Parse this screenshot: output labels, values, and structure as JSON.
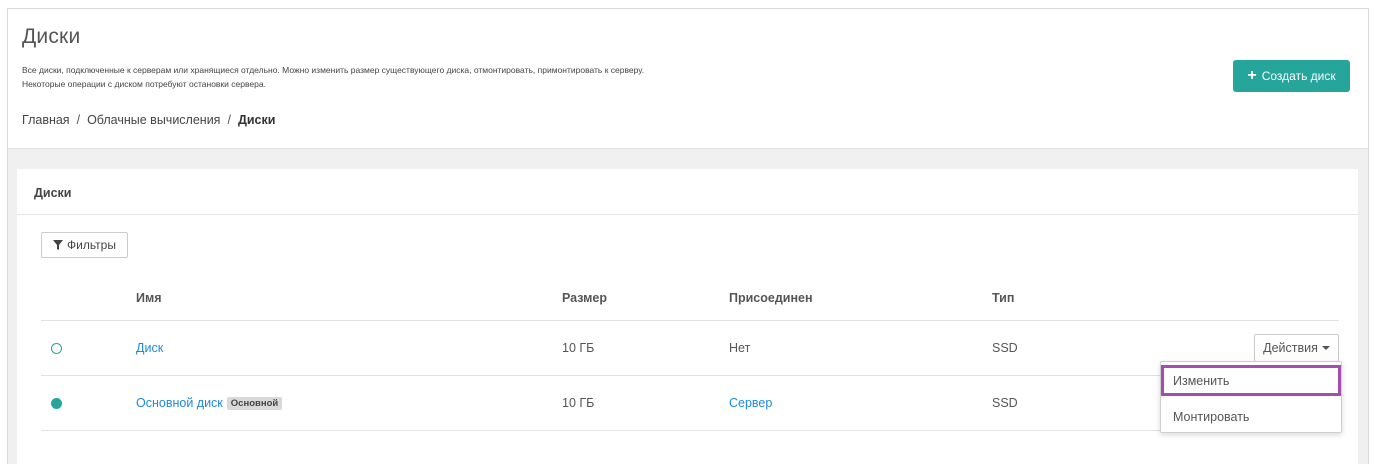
{
  "header": {
    "title": "Диски",
    "description_line1": "Все диски, подключенные к серверам или хранящиеся отдельно. Можно изменить размер существующего диска, отмонтировать, примонтировать к серверу.",
    "description_line2": "Некоторые операции с диском потребуют остановки сервера.",
    "create_button_icon": "+",
    "create_button_label": "Создать диск"
  },
  "breadcrumb": {
    "items": [
      "Главная",
      "Облачные вычисления",
      "Диски"
    ],
    "separator": "/"
  },
  "card": {
    "title": "Диски",
    "filter_button_label": "Фильтры"
  },
  "table": {
    "columns": [
      "Имя",
      "Размер",
      "Присоединен",
      "Тип"
    ],
    "rows": [
      {
        "status": "inactive",
        "name": "Диск",
        "badge": "",
        "size": "10 ГБ",
        "attached": "Нет",
        "attached_is_link": false,
        "type": "SSD"
      },
      {
        "status": "active",
        "name": "Основной диск",
        "badge": "Основной",
        "size": "10 ГБ",
        "attached": "Сервер",
        "attached_is_link": true,
        "type": "SSD"
      }
    ],
    "actions_label": "Действия"
  },
  "dropdown": {
    "items": [
      "Изменить",
      "Монтировать"
    ],
    "highlighted": "Изменить"
  },
  "colors": {
    "accent": "#26a69a",
    "link": "#1e88e5",
    "highlight_border": "#a24fb0"
  }
}
